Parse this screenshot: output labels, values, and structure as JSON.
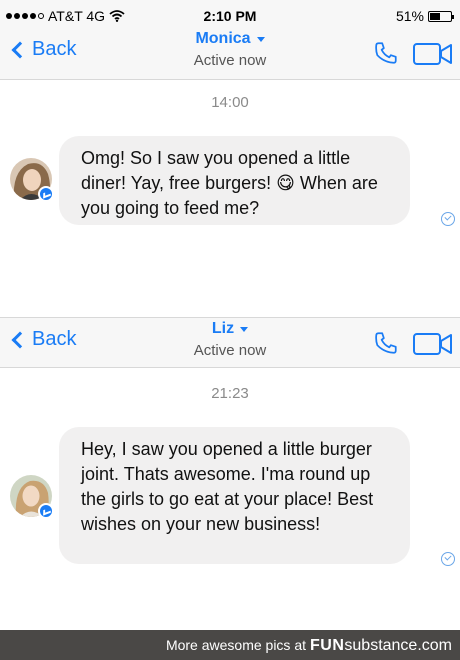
{
  "status_bar": {
    "carrier": "AT&T 4G",
    "time": "2:10 PM",
    "battery": "51%",
    "battery_level": 0.51
  },
  "conversations": [
    {
      "back_label": "Back",
      "contact_name": "Monica",
      "active_status": "Active now",
      "timestamp": "14:00",
      "message": "Omg! So I saw you opened a little diner! Yay, free burgers! 😋 When are you going to feed me?"
    },
    {
      "back_label": "Back",
      "contact_name": "Liz",
      "active_status": "Active now",
      "timestamp": "21:23",
      "message": "Hey, I saw you opened a little burger joint. Thats awesome. I'ma round up the girls to go eat at your place! Best wishes on your new business!"
    }
  ],
  "footer": {
    "text": "More awesome pics at",
    "brand_bold": "FUN",
    "brand_rest": "substance.com"
  },
  "colors": {
    "accent": "#1a7cf5",
    "bubble": "#f1f0f0",
    "footer_bg": "#4a4846"
  },
  "icons": [
    "wifi-icon",
    "back-chevron-icon",
    "phone-icon",
    "video-icon",
    "messenger-badge-icon",
    "seen-check-icon"
  ]
}
